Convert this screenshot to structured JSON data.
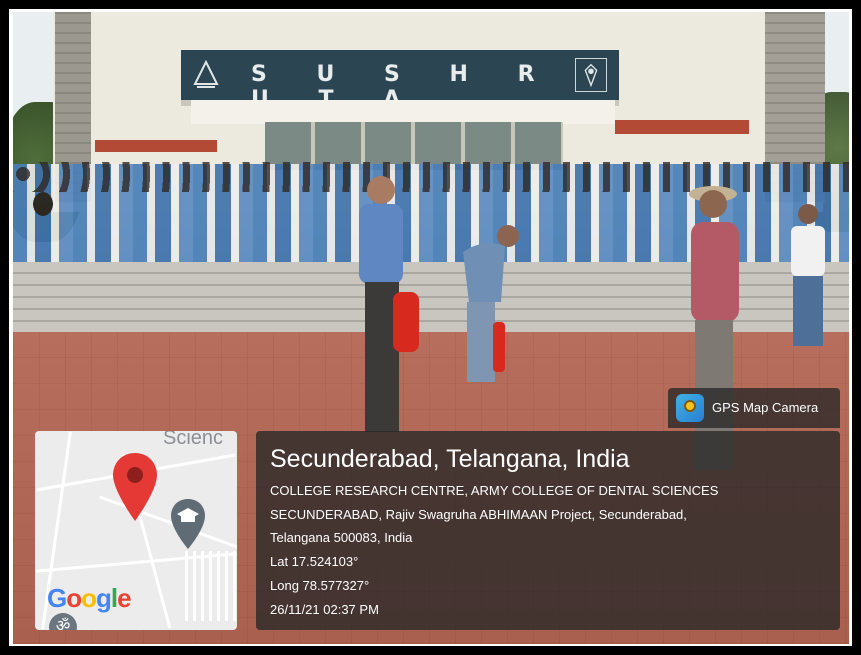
{
  "photo": {
    "building_sign": "S U S H R U T A"
  },
  "gps_badge": {
    "label": "GPS Map Camera",
    "icon": "gps-map-camera-app-icon"
  },
  "location": {
    "title": "Secunderabad, Telangana, India",
    "address_line_1": "COLLEGE RESEARCH CENTRE, ARMY COLLEGE OF DENTAL SCIENCES",
    "address_line_2": "SECUNDERABAD, Rajiv Swagruha ABHIMAAN Project, Secunderabad,",
    "address_line_3": "Telangana 500083, India",
    "lat": "Lat 17.524103°",
    "long": "Long 78.577327°",
    "timestamp": "26/11/21 02:37 PM"
  },
  "map": {
    "label": "Scienc",
    "logo": "Google",
    "pin_icon": "map-pin-icon",
    "school_icon": "school-icon"
  },
  "colors": {
    "pin": "#e53935",
    "school_pin": "#5f6b75",
    "overlay": "#282828"
  }
}
